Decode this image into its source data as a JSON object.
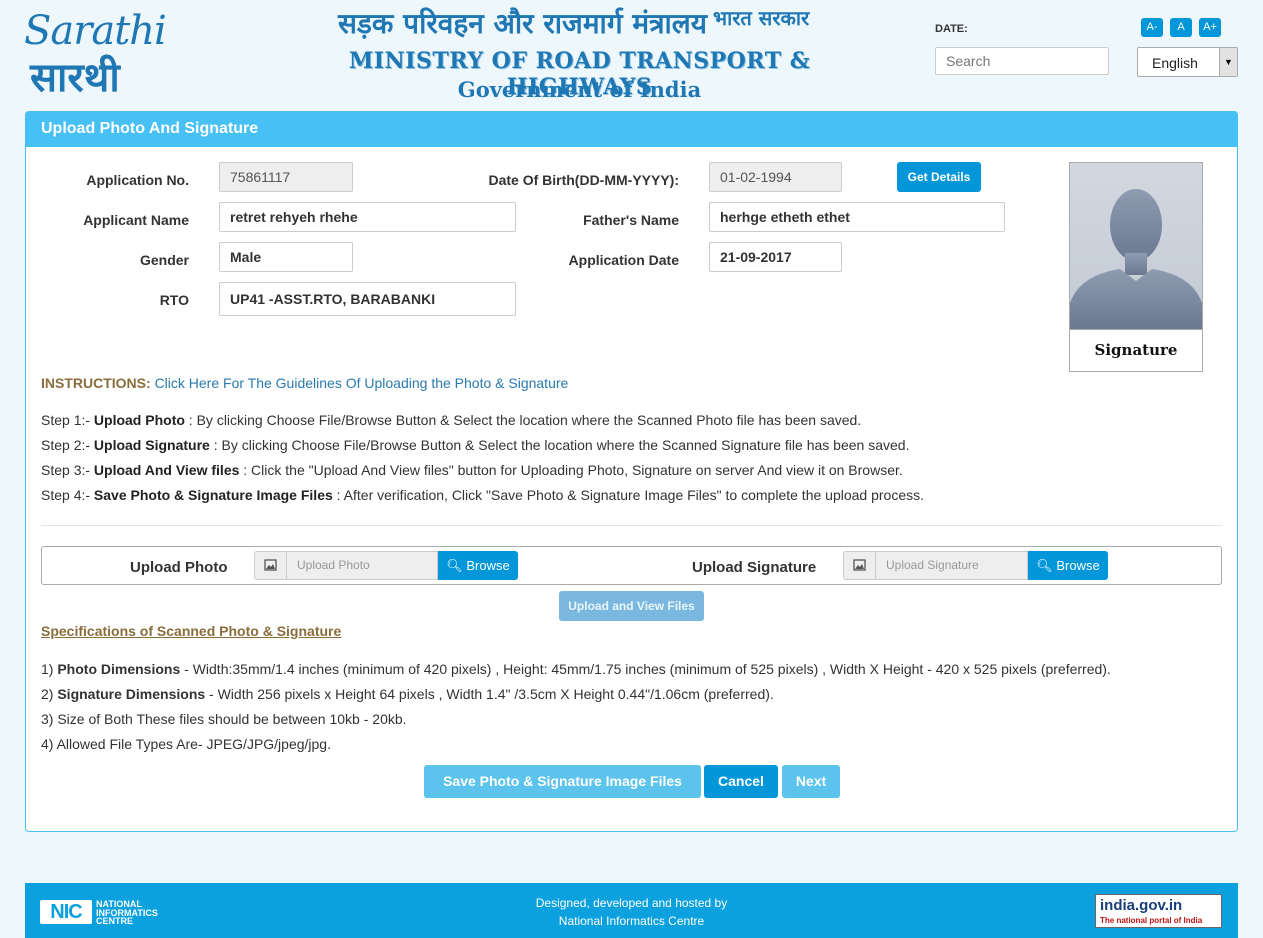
{
  "header": {
    "logo_en": "Sarathi",
    "logo_hi": "सारथी",
    "ministry_hindi": "सड़क परिवहन और राजमार्ग मंत्रालय",
    "ministry_hindi_suffix": "भारत सरकार",
    "ministry_en": "MINISTRY OF ROAD TRANSPORT & HIGHWAYS",
    "government": "Government of India",
    "date_label": "DATE:",
    "search_placeholder": "Search",
    "font_small": "A-",
    "font_normal": "A",
    "font_large": "A+",
    "language": "English"
  },
  "panel": {
    "title": "Upload Photo And Signature"
  },
  "form": {
    "application_no_label": "Application No.",
    "application_no": "75861117",
    "dob_label": "Date Of Birth(DD-MM-YYYY):",
    "dob": "01-02-1994",
    "get_details": "Get Details",
    "applicant_name_label": "Applicant Name",
    "applicant_name": "retret rehyeh rhehe",
    "father_name_label": "Father's Name",
    "father_name": "herhge etheth ethet",
    "gender_label": "Gender",
    "gender": "Male",
    "application_date_label": "Application Date",
    "application_date": "21-09-2017",
    "rto_label": "RTO",
    "rto": "UP41 -ASST.RTO, BARABANKI",
    "signature_caption": "Signature"
  },
  "instructions": {
    "label": "INSTRUCTIONS:",
    "link": "Click Here For The Guidelines Of Uploading the Photo & Signature",
    "steps": [
      {
        "prefix": "Step 1:- ",
        "bold": "Upload Photo",
        "text": " : By clicking Choose File/Browse Button & Select the location where the Scanned Photo file has been saved."
      },
      {
        "prefix": "Step 2:- ",
        "bold": "Upload Signature",
        "text": " : By clicking Choose File/Browse Button & Select the location where the Scanned Signature file has been saved."
      },
      {
        "prefix": "Step 3:- ",
        "bold": "Upload And View files",
        "text": " : Click the \"Upload And View files\" button for Uploading Photo, Signature on server And view it on Browser."
      },
      {
        "prefix": "Step 4:- ",
        "bold": "Save Photo & Signature Image Files",
        "text": " : After verification, Click \"Save Photo & Signature Image Files\" to complete the upload process."
      }
    ]
  },
  "upload": {
    "photo_label": "Upload Photo",
    "photo_placeholder": "Upload Photo",
    "signature_label": "Upload Signature",
    "signature_placeholder": "Upload Signature",
    "browse": "Browse",
    "upload_view": "Upload and View Files"
  },
  "specs": {
    "title": "Specifications of Scanned Photo & Signature",
    "items": [
      {
        "prefix": "1) ",
        "bold": "Photo Dimensions",
        "text": " - Width:35mm/1.4 inches (minimum of 420 pixels) , Height: 45mm/1.75 inches (minimum of 525 pixels) , Width X Height - 420 x 525 pixels (preferred)."
      },
      {
        "prefix": "2) ",
        "bold": "Signature Dimensions",
        "text": " - Width 256 pixels x Height 64 pixels , Width 1.4\" /3.5cm X Height 0.44\"/1.06cm (preferred)."
      },
      {
        "prefix": "",
        "bold": "",
        "text": "3) Size of Both These files should be between 10kb - 20kb."
      },
      {
        "prefix": "",
        "bold": "",
        "text": "4) Allowed File Types Are- JPEG/JPG/jpeg/jpg."
      }
    ]
  },
  "actions": {
    "save": "Save Photo & Signature Image Files",
    "cancel": "Cancel",
    "next": "Next"
  },
  "footer": {
    "nic_logo": "NIC",
    "nic_line1": "NATIONAL",
    "nic_line2": "INFORMATICS",
    "nic_line3": "CENTRE",
    "line1": "Designed, developed and hosted by",
    "line2": "National Informatics Centre",
    "india_gov": "india.gov.in",
    "india_gov_tag": "The national portal of India"
  },
  "colors": {
    "primary": "#0396d8",
    "panel_header": "#47c0f5",
    "footer": "#0ba1de",
    "instruction_label": "#8a6d3b"
  }
}
